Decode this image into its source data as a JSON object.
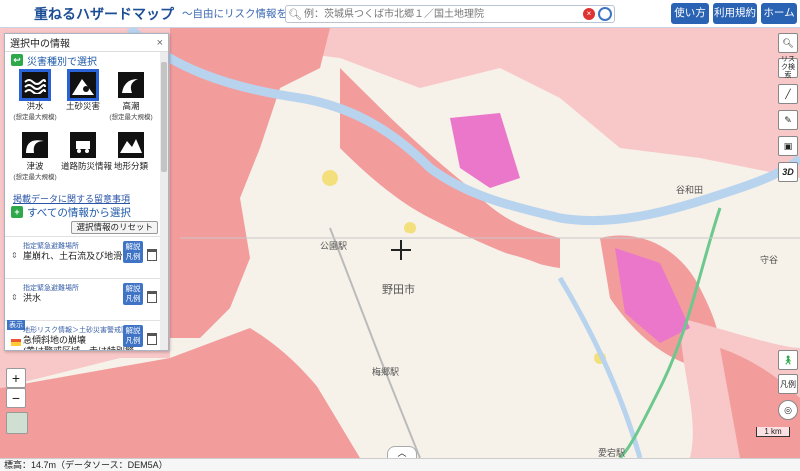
{
  "header": {
    "title": "重ねるハザードマップ",
    "subtitle": "～自由にリスク情報を調べる～",
    "search_placeholder": "例：茨城県つくば市北郷１／国土地理院",
    "buttons": [
      "使い方",
      "利用規約",
      "ホーム"
    ]
  },
  "panel": {
    "title": "選択中の情報",
    "hazard_section": "災害種別で選択",
    "hazards": [
      {
        "label": "洪水",
        "sub": "(想定最大規模)",
        "icon": "flood-icon",
        "selected": true
      },
      {
        "label": "土砂災害",
        "sub": "",
        "icon": "landslide-icon",
        "selected": true
      },
      {
        "label": "高潮",
        "sub": "(想定最大規模)",
        "icon": "storm-surge-icon",
        "selected": false
      },
      {
        "label": "津波",
        "sub": "(想定最大規模)",
        "icon": "tsunami-icon",
        "selected": false
      },
      {
        "label": "道路防災情報",
        "sub": "",
        "icon": "road-icon",
        "selected": false
      },
      {
        "label": "地形分類",
        "sub": "",
        "icon": "terrain-icon",
        "selected": false
      }
    ],
    "notice_link": "掲載データに関する留意事項",
    "all_section": "すべての情報から選択",
    "reset_label": "選択情報のリセット",
    "layers": [
      {
        "category": "指定緊急避難場所",
        "name": "崖崩れ、土石流及び地滑り",
        "legend": "解説\n凡例"
      },
      {
        "category": "指定緊急避難場所",
        "name": "洪水",
        "legend": "解説\n凡例"
      },
      {
        "category": "地形リスク情報＞土砂災害警戒区域",
        "name": "急傾斜地の崩壊\n(黄は警戒区域、赤は特別警",
        "legend": "解説\n凡例",
        "tag": "表示"
      }
    ]
  },
  "map": {
    "labels": [
      "公園駅",
      "野田市",
      "谷和田",
      "梅郷駅",
      "愛宕駅",
      "守谷"
    ],
    "scale": "1 km"
  },
  "tools": {
    "risk_search": "リスク検索",
    "legend": "凡例",
    "view3d": "3D"
  },
  "status": "標高：14.7m（データソース：DEM5A）",
  "colors": {
    "flood_light": "#f8c7c7",
    "flood_dark": "#f29c9c",
    "landslide": "#ea77c9",
    "river": "#b8d3ee",
    "yellow": "#f3e07d",
    "accent": "#2a63b4"
  }
}
